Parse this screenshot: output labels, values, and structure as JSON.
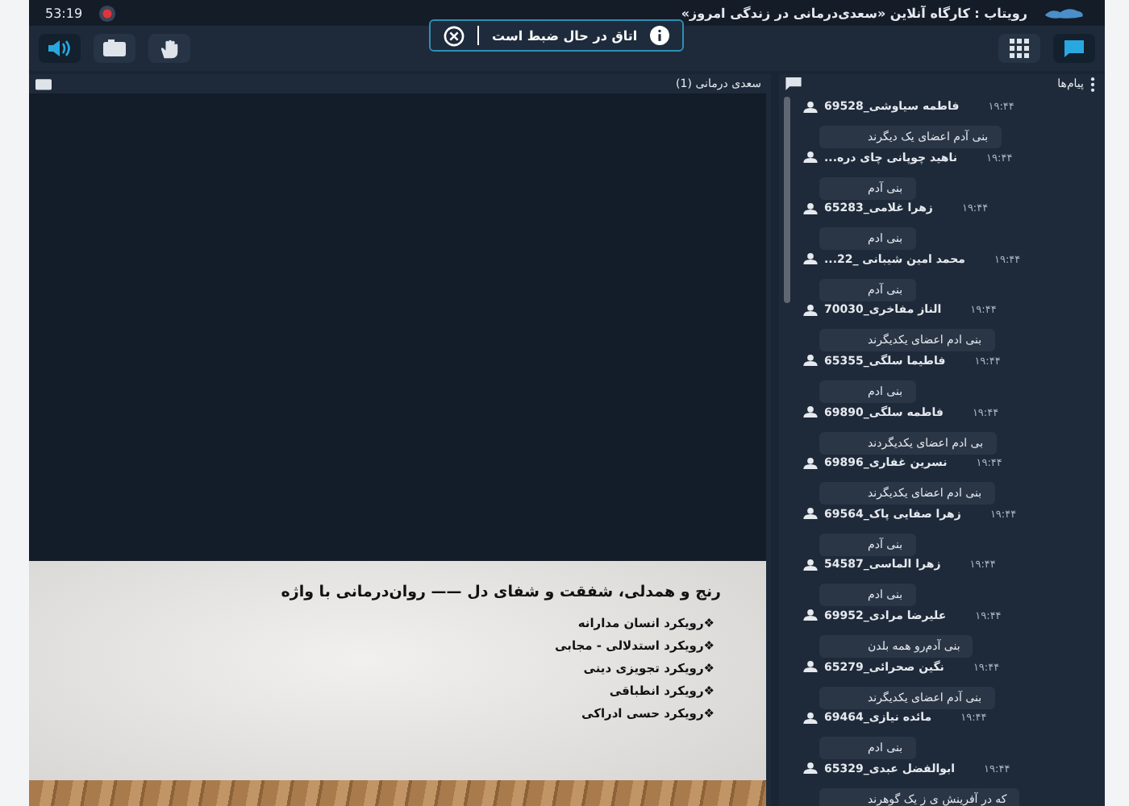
{
  "title_bar": {
    "title": "رویتاب : کارگاه آنلاین «سعدی‌درمانی در زندگی امروز»",
    "timer": "53:19",
    "recording": true
  },
  "toast": {
    "message": "اتاق در حال ضبط است"
  },
  "toolbar": {
    "left_tools": [
      {
        "kind": "speaker",
        "selected": true
      },
      {
        "kind": "screen",
        "selected": false
      },
      {
        "kind": "hand",
        "selected": false
      }
    ],
    "right_tools": [
      {
        "kind": "grid",
        "selected": false
      },
      {
        "kind": "chat",
        "selected": true
      }
    ]
  },
  "presentation": {
    "title": "سعدی درمانی (1)",
    "slide": {
      "heading": "رنج و همدلی، شفقت و شفای دل —— روان‌درمانی با واژه",
      "bullets": [
        "❖رویکرد انسان مدارانه",
        "❖رویکرد استدلالی - مجابی",
        "❖رویکرد تجویزی دینی",
        "❖رویکرد انطباقی",
        "❖رویکرد حسی ادراکی"
      ]
    }
  },
  "chat": {
    "title": "پیام‌ها",
    "messages": [
      {
        "name": "فاطمه سیاوشی_69528",
        "time": "۱۹:۴۴",
        "text": "بنی آدم اعضای یک دیگرند"
      },
      {
        "name": "ناهید چوپانی چای دره...",
        "time": "۱۹:۴۴",
        "text": "بنی آدم"
      },
      {
        "name": "زهرا غلامی_65283",
        "time": "۱۹:۴۴",
        "text": "بنی ادم"
      },
      {
        "name": "محمد امین شیبانی _22...",
        "time": "۱۹:۴۴",
        "text": "بنی آدم"
      },
      {
        "name": "الناز مفاخری_70030",
        "time": "۱۹:۴۴",
        "text": "بنی ادم اعضای یکدیگرند"
      },
      {
        "name": "فاطیما سلگی_65355",
        "time": "۱۹:۴۴",
        "text": "بنی ادم"
      },
      {
        "name": "فاطمه سلگی_69890",
        "time": "۱۹:۴۴",
        "text": "بی ادم اعضای یکدیگردند"
      },
      {
        "name": "نسرین غفاری_69896",
        "time": "۱۹:۴۴",
        "text": "بنی ادم اعضای یکدیگرند"
      },
      {
        "name": "زهرا صفایی پاک_69564",
        "time": "۱۹:۴۴",
        "text": "بنی آدم"
      },
      {
        "name": "زهرا الماسی_54587",
        "time": "۱۹:۴۴",
        "text": "بنی ادم"
      },
      {
        "name": "علیرضا مرادی_69952",
        "time": "۱۹:۴۴",
        "text": "بنی آدم‌رو همه بلدن"
      },
      {
        "name": "نگین صحرائی_65279",
        "time": "۱۹:۴۴",
        "text": "بنی آدم اعضای یکدیگرند"
      },
      {
        "name": "مائده نیازی_69464",
        "time": "۱۹:۴۴",
        "text": "بنی ادم"
      },
      {
        "name": "ابوالفضل عبدی_65329",
        "time": "۱۹:۴۴",
        "text": "که در آفرینش ی ز یک گوهرند"
      }
    ]
  }
}
